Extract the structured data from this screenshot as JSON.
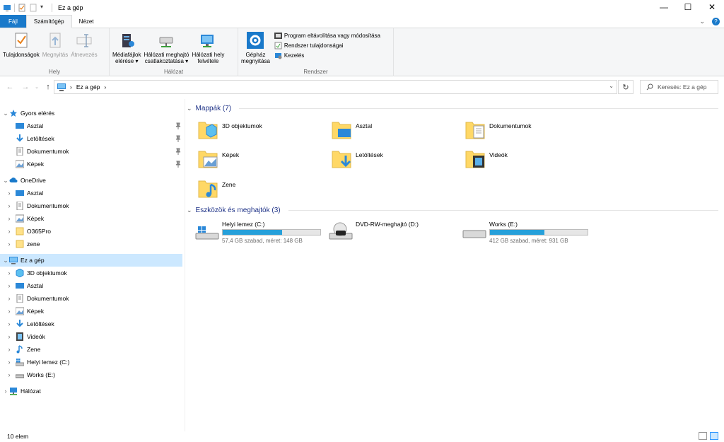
{
  "window": {
    "title": "Ez a gép",
    "minimize": "—",
    "maximize": "☐",
    "close": "✕"
  },
  "tabs": {
    "file": "Fájl",
    "computer": "Számítógép",
    "view": "Nézet"
  },
  "ribbon": {
    "location_group": {
      "label": "Hely",
      "properties": "Tulajdonságok",
      "open": "Megnyitás",
      "rename": "Átnevezés"
    },
    "network_group": {
      "label": "Hálózat",
      "media_line1": "Médiafájlok",
      "media_line2": "elérése ▾",
      "map_line1": "Hálózati meghajtó",
      "map_line2": "csatlakoztatása ▾",
      "add_line1": "Hálózati hely",
      "add_line2": "felvétele"
    },
    "system_group": {
      "label": "Rendszer",
      "settings_line1": "Gépház",
      "settings_line2": "megnyitása",
      "uninstall": "Program eltávolítása vagy módosítása",
      "sysprops": "Rendszer tulajdonságai",
      "manage": "Kezelés"
    }
  },
  "nav": {
    "back": "←",
    "forward": "→",
    "up": "↑",
    "address": "Ez a gép",
    "address_sep": "›",
    "refresh": "↻",
    "search_placeholder": "Keresés: Ez a gép"
  },
  "navpane": {
    "quick_access": "Gyors elérés",
    "qa_items": [
      "Asztal",
      "Letöltések",
      "Dokumentumok",
      "Képek"
    ],
    "onedrive": "OneDrive",
    "od_items": [
      "Asztal",
      "Dokumentumok",
      "Képek",
      "O365Pro",
      "zene"
    ],
    "this_pc": "Ez a gép",
    "pc_items": [
      "3D objektumok",
      "Asztal",
      "Dokumentumok",
      "Képek",
      "Letöltések",
      "Videók",
      "Zene",
      "Helyi lemez (C:)",
      "Works (E:)"
    ],
    "network": "Hálózat"
  },
  "content": {
    "folders_header": "Mappák (7)",
    "folders": [
      "3D objektumok",
      "Asztal",
      "Dokumentumok",
      "Képek",
      "Letöltések",
      "Videók",
      "Zene"
    ],
    "devices_header": "Eszközök és meghajtók (3)",
    "drives": [
      {
        "name": "Helyi lemez (C:)",
        "free": "57,4 GB szabad, méret: 148 GB",
        "used_fraction": 0.61
      },
      {
        "name": "DVD-RW-meghajtó (D:)",
        "free": "",
        "used_fraction": null
      },
      {
        "name": "Works (E:)",
        "free": "412 GB szabad, méret: 931 GB",
        "used_fraction": 0.56
      }
    ]
  },
  "status": {
    "count": "10 elem"
  },
  "colors": {
    "accent": "#1979ca",
    "selection": "#cce8ff",
    "folder": "#ffd866",
    "bar": "#26a0da"
  }
}
